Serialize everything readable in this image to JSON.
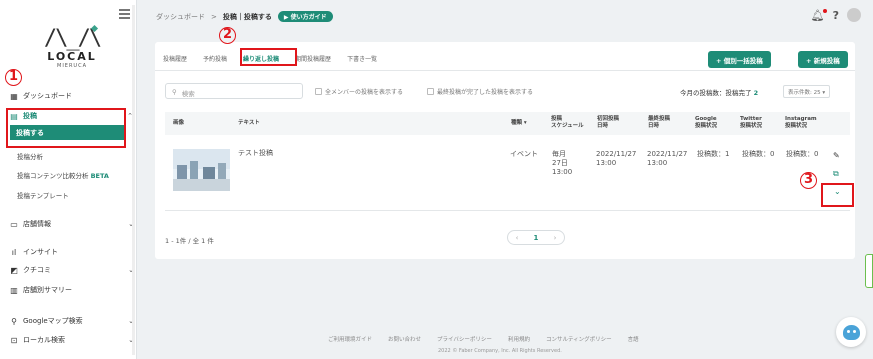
{
  "sidebar": {
    "logo_word": "LOCAL",
    "logo_sub": "MIERUCA",
    "items": [
      {
        "label": "ダッシュボード",
        "icon": "dashboard-icon"
      },
      {
        "label": "投稿",
        "icon": "post-icon"
      },
      {
        "label": "店舗情報",
        "icon": "store-icon"
      },
      {
        "label": "インサイト",
        "icon": "chart-icon"
      },
      {
        "label": "クチコミ",
        "icon": "review-icon"
      },
      {
        "label": "店舗別サマリー",
        "icon": "summary-icon"
      },
      {
        "label": "Googleマップ検索",
        "icon": "pin-icon"
      },
      {
        "label": "ローカル検索",
        "icon": "search-icon"
      }
    ],
    "post_subitems": {
      "active": "投稿する",
      "analysis": "投稿分析",
      "content_compare": "投稿コンテンツ比較分析",
      "beta": "BETA",
      "template": "投稿テンプレート"
    }
  },
  "annotations": {
    "one": "1",
    "two": "2",
    "three": "3"
  },
  "header": {
    "breadcrumb_root": "ダッシュボード",
    "breadcrumb_sep": ">",
    "breadcrumb_current": "投稿｜投稿する",
    "guide_label": "使い方ガイド",
    "help_icon": "?"
  },
  "tabs": [
    "投稿履歴",
    "予約投稿",
    "繰り返し投稿",
    "期間投稿履歴",
    "下書き一覧"
  ],
  "buttons": {
    "bulk_post": "+ 個別一括投稿",
    "new_post": "+ 新規投稿"
  },
  "filters": {
    "search_placeholder": "検索",
    "all_members": "全メンバーの投稿を表示する",
    "finished": "最終投稿が完了した投稿を表示する",
    "count_label": "今月の投稿数：投稿完了",
    "count_value": "2",
    "per_page": "表示件数: 25 ▾"
  },
  "table": {
    "headers": {
      "image": "画像",
      "text": "テキスト",
      "type": "種類 ▾",
      "schedule": "投稿\nスケジュール",
      "first": "初回投稿\n日時",
      "last": "最終投稿\n日時",
      "google": "Google\n投稿状況",
      "twitter": "Twitter\n投稿状況",
      "instagram": "Instagram\n投稿状況"
    },
    "row": {
      "text": "テスト投稿",
      "type": "イベント",
      "schedule": "毎月\n27日\n13:00",
      "first": "2022/11/27\n13:00",
      "last": "2022/11/27\n13:00",
      "google": "投稿数：1",
      "twitter": "投稿数：0",
      "instagram": "投稿数：0"
    }
  },
  "pagination": {
    "summary": "1 - 1件 / 全 1 件",
    "prev": "‹",
    "current": "1",
    "next": "›"
  },
  "footer": {
    "links": [
      "ご利用環境ガイド",
      "お問い合わせ",
      "プライバシーポリシー",
      "利用規約",
      "コンサルティングポリシー",
      "言語"
    ],
    "copyright": "2022 © Faber Company, Inc. All Rights Reserved."
  },
  "colors": {
    "accent": "#1e8c77",
    "annotation": "#e0161b"
  }
}
